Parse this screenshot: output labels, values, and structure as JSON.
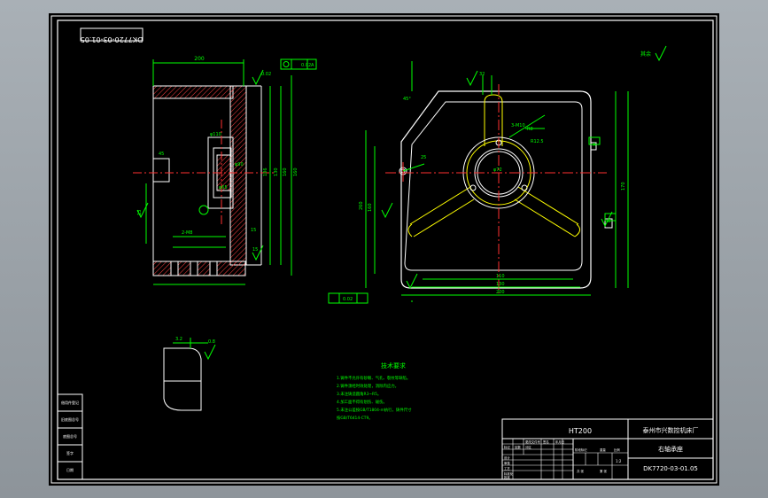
{
  "drawing": {
    "rotated_code": "DK7720-03-01.05",
    "section_label": "A-A",
    "tech_title": "技术要求",
    "tech_notes": [
      "1.铸件不允许有砂眼、气孔、裂纹等缺陷。",
      "2.铸件须经时效处理，消除内应力。",
      "3.未注铸造圆角R3~R5。",
      "4.加工面不得有划伤、碰伤。",
      "5.未注公差按GB/T1804-m执行，铸件尺寸",
      "  按GB/T6414-CT9。"
    ],
    "roughness_note": "其余",
    "material": "HT200",
    "company": "泰州市兴数控机床厂",
    "part_name": "右轴承座",
    "drawing_code": "DK7720-03-01.05",
    "scale": "1:2",
    "left_column": [
      "借用件登记",
      "旧底图总号",
      "底图总号",
      "签字",
      "日期"
    ],
    "title_small": [
      "标记",
      "处数",
      "分区",
      "更改文件号",
      "签名",
      "年月日",
      "设计",
      "审核",
      "工艺",
      "标准化",
      "批准",
      "阶段标记",
      "重量",
      "比例",
      "共 张",
      "第 张"
    ]
  },
  "dims": {
    "left": [
      "200",
      "0.02",
      "0.02",
      "A",
      "160",
      "45",
      "13",
      "15",
      "2-M8",
      "φ110",
      "φ90",
      "106",
      "130",
      "160",
      "φ65",
      "15"
    ],
    "right": [
      "45°",
      "R8",
      "3-M10",
      "R12.5",
      "25",
      "φ72",
      "260",
      "160",
      "110",
      "0.02",
      "130",
      "200",
      "170",
      "A",
      "B",
      "32"
    ],
    "detail": [
      "3.2",
      "0.8"
    ]
  },
  "colors": {
    "background": "#000000",
    "border": "#ffffff",
    "outline": "#ffffff",
    "dimension": "#00ff00",
    "center": "#ff3030",
    "hatch": "#ff4040",
    "inner": "#ffff00"
  }
}
